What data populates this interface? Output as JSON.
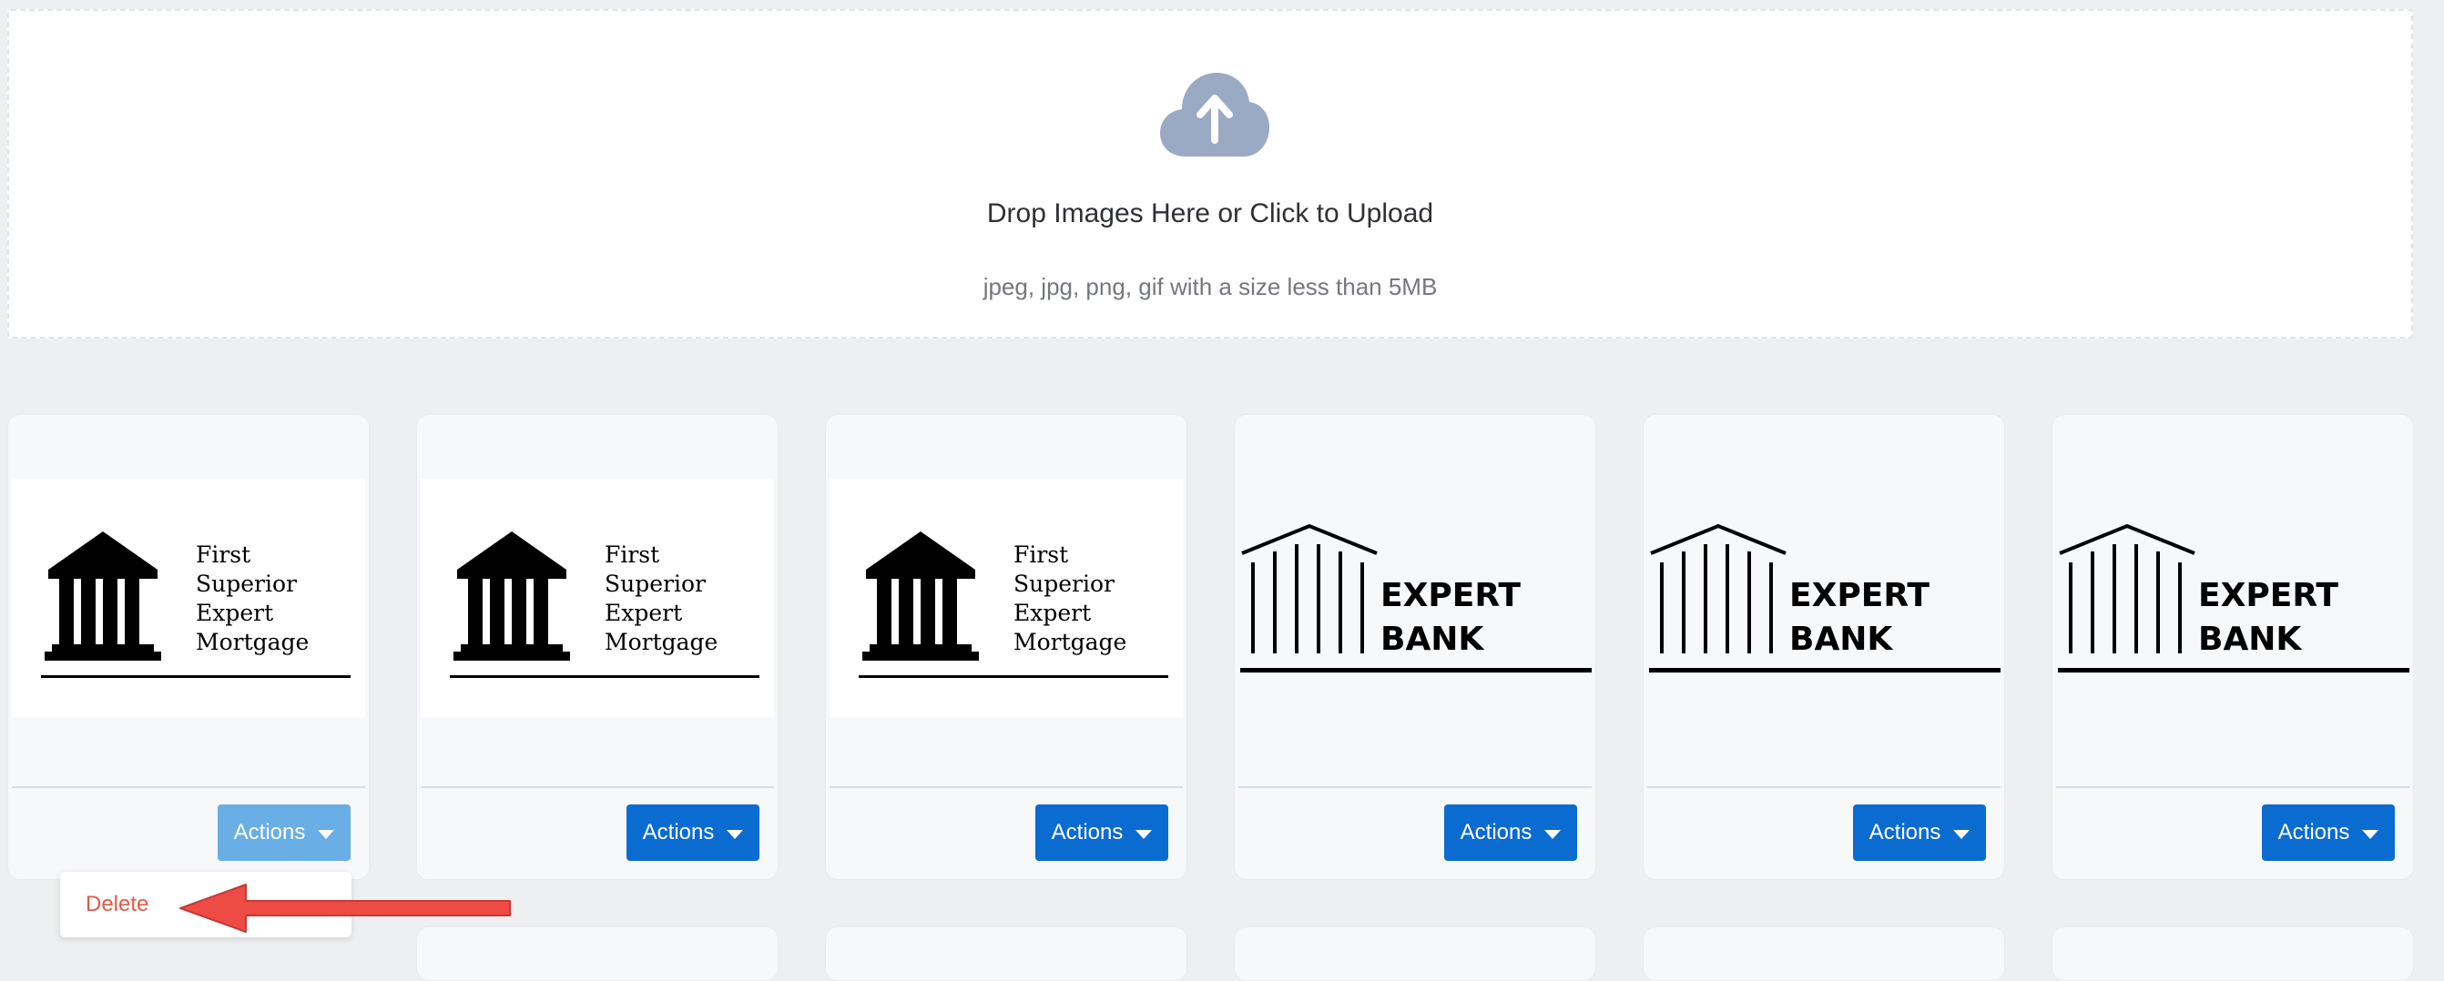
{
  "upload": {
    "icon": "cloud-upload-icon",
    "title": "Drop Images Here or Click to Upload",
    "hint": "jpeg, jpg, png, gif with a size less than 5MB"
  },
  "cards": [
    {
      "logo": "mortgage",
      "logo_lines": [
        "First",
        "Superior",
        "Expert",
        "Mortgage"
      ],
      "actions_label": "Actions",
      "menu_open": true
    },
    {
      "logo": "mortgage",
      "logo_lines": [
        "First",
        "Superior",
        "Expert",
        "Mortgage"
      ],
      "actions_label": "Actions",
      "menu_open": false
    },
    {
      "logo": "mortgage",
      "logo_lines": [
        "First",
        "Superior",
        "Expert",
        "Mortgage"
      ],
      "actions_label": "Actions",
      "menu_open": false
    },
    {
      "logo": "bank",
      "logo_lines": [
        "EXPERT",
        "BANK"
      ],
      "actions_label": "Actions",
      "menu_open": false
    },
    {
      "logo": "bank",
      "logo_lines": [
        "EXPERT",
        "BANK"
      ],
      "actions_label": "Actions",
      "menu_open": false
    },
    {
      "logo": "bank",
      "logo_lines": [
        "EXPERT",
        "BANK"
      ],
      "actions_label": "Actions",
      "menu_open": false
    }
  ],
  "dropdown": {
    "delete_label": "Delete"
  },
  "colors": {
    "accent": "#0a6bd1",
    "accent_active": "#6aaee6",
    "danger": "#e25a4a",
    "annotation_arrow": "#ef4b45"
  }
}
